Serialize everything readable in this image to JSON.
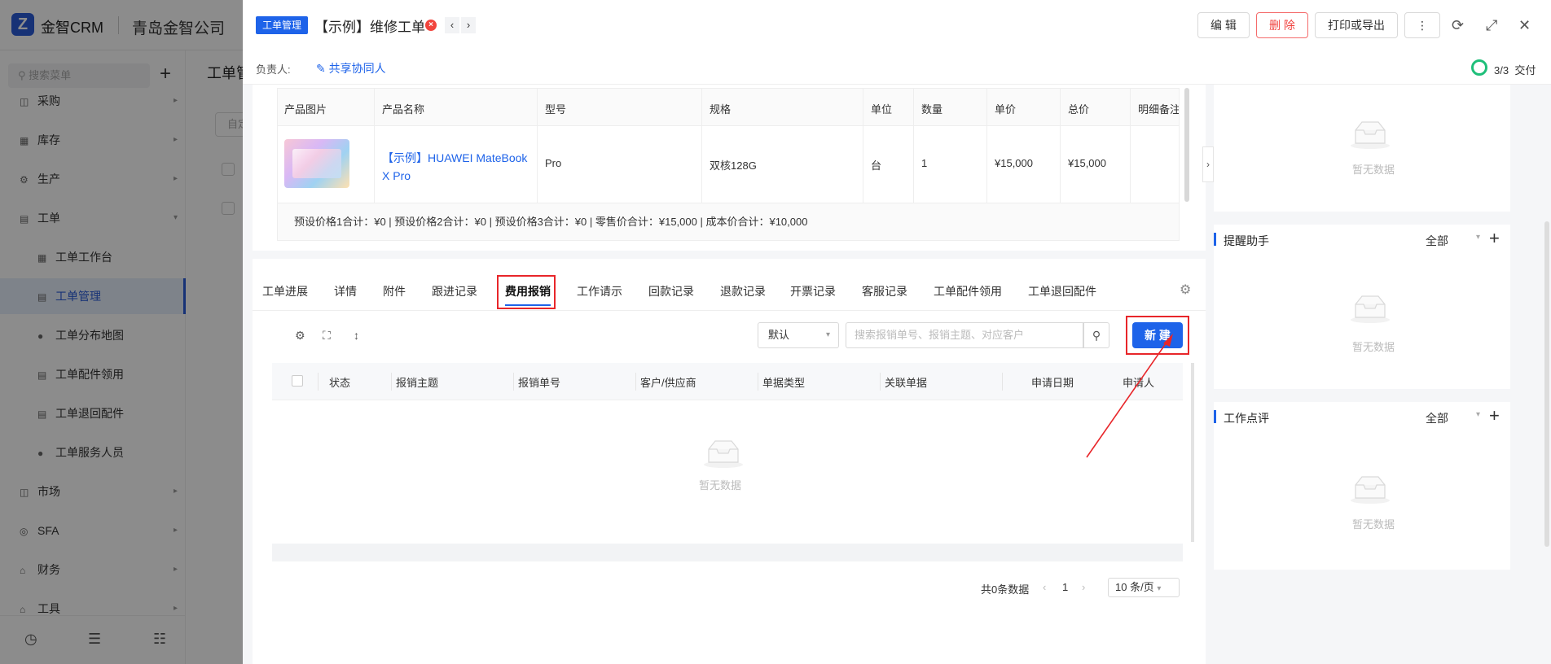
{
  "app": {
    "brand": "金智CRM",
    "company": "青岛金智公司",
    "bg_page_title": "工单管",
    "bg_filter": "自定"
  },
  "sidebar": {
    "search_placeholder": "搜索菜单",
    "items": [
      {
        "label": "采购",
        "icon": "cart-icon"
      },
      {
        "label": "库存",
        "icon": "warehouse-icon"
      },
      {
        "label": "生产",
        "icon": "production-icon"
      },
      {
        "label": "工单",
        "icon": "workorder-icon"
      },
      {
        "label": "工单工作台",
        "icon": "dashboard-icon"
      },
      {
        "label": "工单管理",
        "icon": "doc-icon"
      },
      {
        "label": "工单分布地图",
        "icon": "person-icon"
      },
      {
        "label": "工单配件领用",
        "icon": "doc-icon"
      },
      {
        "label": "工单退回配件",
        "icon": "doc-icon"
      },
      {
        "label": "工单服务人员",
        "icon": "person-icon"
      },
      {
        "label": "市场",
        "icon": "market-icon"
      },
      {
        "label": "SFA",
        "icon": "sfa-icon"
      },
      {
        "label": "财务",
        "icon": "finance-icon"
      },
      {
        "label": "工具",
        "icon": "tool-icon"
      }
    ]
  },
  "drawer": {
    "tag": "工单管理",
    "title": "【示例】维修工单",
    "buttons": {
      "edit": "编 辑",
      "delete": "删 除",
      "print": "打印或导出"
    },
    "owner_label": "负责人:",
    "share_label": "共享协同人",
    "progress": "3/3",
    "stage": "交付"
  },
  "product_table": {
    "columns": [
      "产品图片",
      "产品名称",
      "型号",
      "规格",
      "单位",
      "数量",
      "单价",
      "总价",
      "明细备注"
    ],
    "row": {
      "name": "【示例】HUAWEI MateBook X Pro",
      "model": "Pro",
      "spec": "双核128G",
      "unit": "台",
      "qty": "1",
      "price": "¥15,000",
      "total": "¥15,000"
    },
    "summary": "预设价格1合计：¥0 |   预设价格2合计：¥0 |   预设价格3合计：¥0 |   零售价合计：¥15,000 |   成本价合计：¥10,000"
  },
  "tabs": [
    "工单进展",
    "详情",
    "附件",
    "跟进记录",
    "费用报销",
    "工作请示",
    "回款记录",
    "退款记录",
    "开票记录",
    "客服记录",
    "工单配件领用",
    "工单退回配件"
  ],
  "active_tab": "费用报销",
  "expense": {
    "view_select": "默认",
    "search_placeholder": "搜索报销单号、报销主题、对应客户",
    "new_button": "新 建",
    "columns": [
      "状态",
      "报销主题",
      "报销单号",
      "客户/供应商",
      "单据类型",
      "关联单据",
      "申请日期",
      "申请人"
    ],
    "empty_text": "暂无数据",
    "pager": {
      "total": "共0条数据",
      "page": "1",
      "size": "10 条/页"
    }
  },
  "right_panels": {
    "top_empty": "暂无数据",
    "reminder": {
      "title": "提醒助手",
      "filter": "全部",
      "empty": "暂无数据"
    },
    "review": {
      "title": "工作点评",
      "filter": "全部",
      "empty": "暂无数据"
    }
  },
  "colors": {
    "primary": "#1e63e9",
    "danger": "#f0413d",
    "highlight": "#e8262a",
    "progress": "#1fbf7a"
  }
}
